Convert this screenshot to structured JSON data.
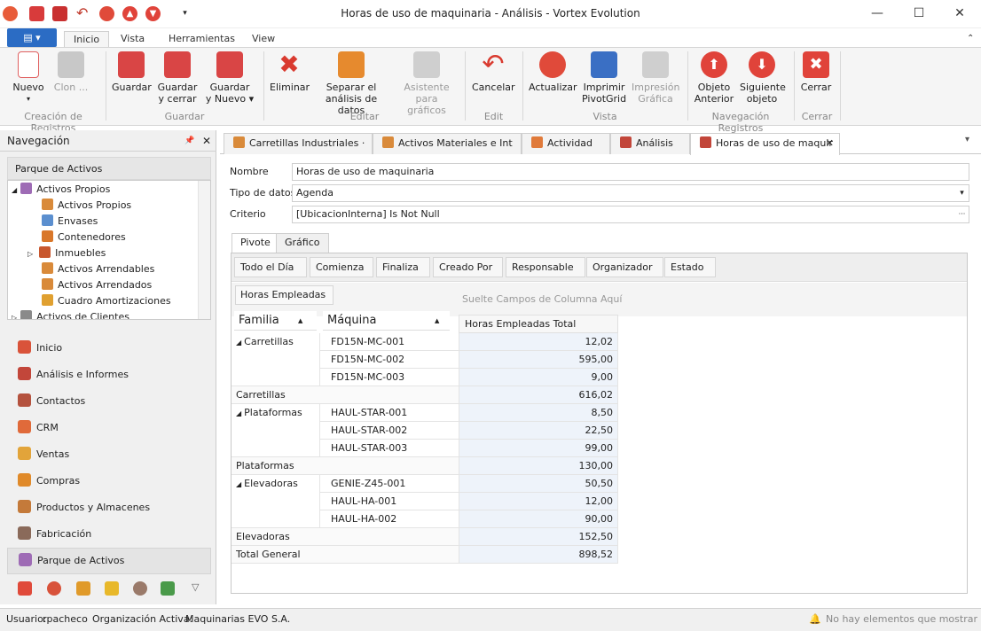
{
  "window": {
    "title": "Horas de uso de maquinaria - Análisis - Vortex Evolution",
    "minimize_glyph": "—",
    "maximize_glyph": "☐",
    "close_glyph": "✕",
    "quick_access_icons": [
      "app-icon",
      "save-icon",
      "save-close-icon",
      "undo-icon",
      "refresh-icon",
      "up-icon",
      "down-icon",
      "customize-icon"
    ]
  },
  "ribbon_tabs": {
    "file_glyph": "▤ ▾",
    "tabs": [
      "Inicio",
      "Vista",
      "Herramientas",
      "View"
    ],
    "collapse_glyph": "⌃"
  },
  "ribbon": {
    "buttons": {
      "nuevo": "Nuevo",
      "clon": "Clon ...",
      "guardar": "Guardar",
      "guardar_cerrar_1": "Guardar",
      "guardar_cerrar_2": "y cerrar",
      "guardar_nuevo_1": "Guardar",
      "guardar_nuevo_2": "y Nuevo ▾",
      "eliminar": "Eliminar",
      "separar_1": "Separar el",
      "separar_2": "análisis de datos",
      "asistente_1": "Asistente",
      "asistente_2": "para gráficos",
      "cancelar": "Cancelar",
      "actualizar": "Actualizar",
      "imprimir_1": "Imprimir",
      "imprimir_2": "PivotGrid",
      "impresion_1": "Impresión",
      "impresion_2": "Gráfica",
      "anterior_1": "Objeto",
      "anterior_2": "Anterior",
      "siguiente_1": "Siguiente",
      "siguiente_2": "objeto",
      "cerrar": "Cerrar"
    },
    "groups": {
      "creacion": "Creación de Registros",
      "guardar": "Guardar",
      "editar": "Editar",
      "edit": "Edit",
      "vista": "Vista",
      "navegacion": "Navegación Registros",
      "cerrar": "Cerrar"
    }
  },
  "navigation": {
    "header": "Navegación",
    "pin_glyph": "📌",
    "close_glyph": "✕",
    "section": "Parque de Activos",
    "tree": [
      {
        "label": "Activos Propios",
        "prefix": "◢"
      },
      {
        "label": "Activos Propios",
        "prefix": ""
      },
      {
        "label": "Envases",
        "prefix": ""
      },
      {
        "label": "Contenedores",
        "prefix": ""
      },
      {
        "label": "Inmuebles",
        "prefix": "▷"
      },
      {
        "label": "Activos Arrendables",
        "prefix": ""
      },
      {
        "label": "Activos Arrendados",
        "prefix": ""
      },
      {
        "label": "Cuadro Amortizaciones",
        "prefix": ""
      },
      {
        "label": "Activos de Clientes",
        "prefix": "▷"
      }
    ],
    "items": [
      "Inicio",
      "Análisis e Informes",
      "Contactos",
      "CRM",
      "Ventas",
      "Compras",
      "Productos y Almacenes",
      "Fabricación",
      "Parque de Activos"
    ],
    "more_glyph": "▽"
  },
  "doc_tabs": {
    "tabs": [
      "Carretillas Industriales ·",
      "Activos Materiales e Int",
      "Actividad",
      "Análisis",
      "Horas de uso de maquir"
    ],
    "close_glyph": "✕",
    "menu_glyph": "▾"
  },
  "form": {
    "nombre_label": "Nombre",
    "nombre_value": "Horas de uso de maquinaria",
    "tipo_label": "Tipo de datos",
    "tipo_value": "Agenda",
    "criterio_label": "Criterio",
    "criterio_value": "[UbicacionInterna] Is Not Null",
    "dropdown_glyph": "▾",
    "ellipsis_glyph": "···"
  },
  "subtabs": [
    "Pivote",
    "Gráfico"
  ],
  "pivot": {
    "filter_fields": [
      "Todo el Día",
      "Comienza",
      "Finaliza",
      "Creado Por",
      "Responsable",
      "Organizador",
      "Estado"
    ],
    "data_field": "Horas Empleadas",
    "column_drop_hint": "Suelte Campos de Columna Aquí",
    "row_headers": [
      "Familia",
      "Máquina"
    ],
    "sort_glyph": "▲",
    "value_header": "Horas Empleadas Total",
    "expand_glyph": "◢",
    "groups": [
      {
        "name": "Carretillas",
        "rows": [
          [
            "FD15N-MC-001",
            "12,02"
          ],
          [
            "FD15N-MC-002",
            "595,00"
          ],
          [
            "FD15N-MC-003",
            "9,00"
          ]
        ],
        "total_label": "Carretillas",
        "total": "616,02"
      },
      {
        "name": "Plataformas",
        "rows": [
          [
            "HAUL-STAR-001",
            "8,50"
          ],
          [
            "HAUL-STAR-002",
            "22,50"
          ],
          [
            "HAUL-STAR-003",
            "99,00"
          ]
        ],
        "total_label": "Plataformas",
        "total": "130,00"
      },
      {
        "name": "Elevadoras",
        "rows": [
          [
            "GENIE-Z45-001",
            "50,50"
          ],
          [
            "HAUL-HA-001",
            "12,00"
          ],
          [
            "HAUL-HA-002",
            "90,00"
          ]
        ],
        "total_label": "Elevadoras",
        "total": "152,50"
      }
    ],
    "grand_total_label": "Total General",
    "grand_total": "898,52"
  },
  "status": {
    "usuario_label": "Usuario:",
    "usuario": "rpacheco",
    "org_label": "Organización Activa:",
    "org": "Maquinarias EVO S.A.",
    "notifications": "No hay elementos que mostrar"
  },
  "colors": {
    "accent": "#2b6cc4",
    "value_cell": "#eef3fa",
    "red_icon": "#d93a2f",
    "status_bg": "#f0f0f0"
  }
}
